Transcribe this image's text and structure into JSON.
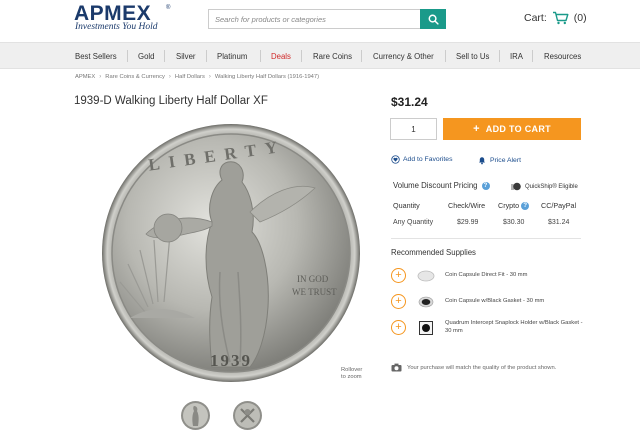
{
  "logo": {
    "name": "APMEX",
    "reg": "®",
    "tagline": "Investments You Hold"
  },
  "search": {
    "placeholder": "Search for products or categories"
  },
  "cart": {
    "label": "Cart:",
    "count": "(0)"
  },
  "nav": [
    "Best Sellers",
    "Gold",
    "Silver",
    "Platinum",
    "Deals",
    "Rare Coins",
    "Currency & Other",
    "Sell to Us",
    "IRA",
    "Resources"
  ],
  "breadcrumb": [
    "APMEX",
    "Rare Coins & Currency",
    "Half Dollars",
    "Walking Liberty Half Dollars (1916-1947)"
  ],
  "product": {
    "title": "1939-D Walking Liberty Half Dollar XF",
    "price": "$31.24",
    "quantity": "1",
    "add_to_cart": "ADD TO CART",
    "add_to_favorites": "Add to Favorites",
    "price_alert": "Price Alert",
    "rollover": [
      "Rollover",
      "to zoom"
    ]
  },
  "volume_discount": {
    "title": "Volume Discount Pricing",
    "quickship": "QuickShip® Eligible",
    "headers": [
      "Quantity",
      "Check/Wire",
      "Crypto",
      "CC/PayPal"
    ],
    "row": [
      "Any Quantity",
      "$29.99",
      "$30.30",
      "$31.24"
    ]
  },
  "recommended": {
    "title": "Recommended Supplies",
    "items": [
      "Coin Capsule Direct Fit - 30 mm",
      "Coin Capsule w/Black Gasket - 30 mm",
      "Quadrum Intercept Snaplock Holder w/Black Gasket - 30 mm"
    ]
  },
  "note": "Your purchase will match the quality of the product shown.",
  "colors": {
    "brand": "#1b3a6b",
    "accent": "#f5961f",
    "search": "#1a9a8a",
    "link": "#1b4c8c",
    "deals": "#d02a2a"
  }
}
